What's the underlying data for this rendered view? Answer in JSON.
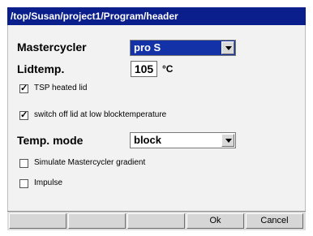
{
  "window": {
    "title": "/top/Susan/project1/Program/header"
  },
  "form": {
    "mastercycler": {
      "label": "Mastercycler",
      "value": "pro S"
    },
    "lidtemp": {
      "label": "Lidtemp.",
      "value": "105",
      "unit": "°C"
    },
    "tsp_heated_lid": {
      "label": "TSP heated lid",
      "checked": true
    },
    "switch_off_lid": {
      "label": "switch off lid at low blocktemperature",
      "checked": true
    },
    "temp_mode": {
      "label": "Temp. mode",
      "value": "block"
    },
    "simulate_gradient": {
      "label": "Simulate Mastercycler gradient",
      "checked": false
    },
    "impulse": {
      "label": "Impulse",
      "checked": false
    }
  },
  "buttons": {
    "ok": "Ok",
    "cancel": "Cancel"
  },
  "colors": {
    "title_bar": "#0a1e8c",
    "selected_combo": "#1432a8"
  }
}
